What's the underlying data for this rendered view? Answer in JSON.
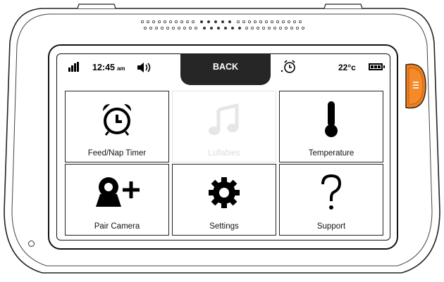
{
  "status": {
    "time": "12:45",
    "ampm": "am",
    "back_label": "BACK",
    "temperature": "22°c",
    "signal_icon": "signal-bars-icon",
    "volume_icon": "speaker-volume-icon",
    "alarm_icon": "alarm-clock-icon",
    "battery_icon": "battery-full-icon"
  },
  "tiles": [
    {
      "label": "Feed/Nap Timer",
      "icon": "alarm-clock-icon",
      "enabled": true
    },
    {
      "label": "Lullabies",
      "icon": "music-note-icon",
      "enabled": false
    },
    {
      "label": "Temperature",
      "icon": "thermometer-icon",
      "enabled": true
    },
    {
      "label": "Pair Camera",
      "icon": "add-camera-icon",
      "enabled": true
    },
    {
      "label": "Settings",
      "icon": "gear-icon",
      "enabled": true
    },
    {
      "label": "Support",
      "icon": "question-mark-icon",
      "enabled": true
    }
  ],
  "colors": {
    "accent": "#f07d1a",
    "back_button_bg": "#262626",
    "disabled_text": "#dcdcdc"
  },
  "device": {
    "side_button_icon": "menu-icon"
  }
}
